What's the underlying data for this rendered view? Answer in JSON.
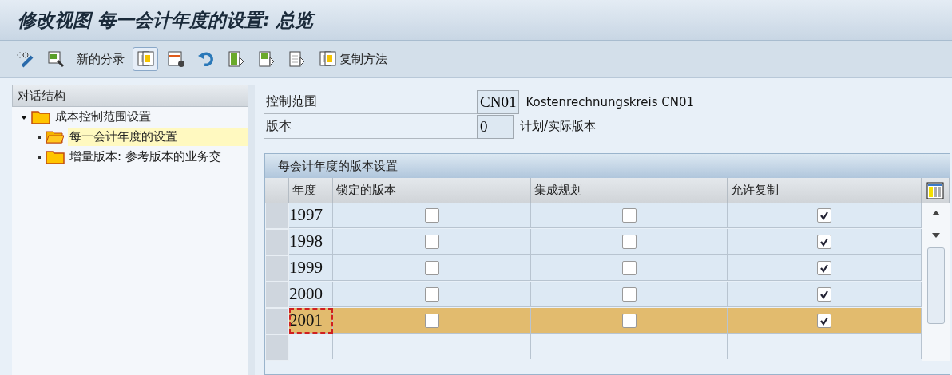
{
  "window": {
    "title": "修改视图 每一会计年度的设置: 总览"
  },
  "toolbar": [
    {
      "kind": "icon",
      "pressed": false
    },
    {
      "kind": "icon",
      "pressed": false
    },
    {
      "kind": "text",
      "label": "新的分录"
    },
    {
      "kind": "icon",
      "pressed": true
    },
    {
      "kind": "icon",
      "pressed": false
    },
    {
      "kind": "icon",
      "pressed": false
    },
    {
      "kind": "icon",
      "pressed": false
    },
    {
      "kind": "icon",
      "pressed": false
    },
    {
      "kind": "icon",
      "pressed": false
    },
    {
      "kind": "icon-text",
      "label": "复制方法",
      "pressed": false
    }
  ],
  "sidebar": {
    "title": "对话结构",
    "items": [
      {
        "label": "成本控制范围设置",
        "expanded": true,
        "selected": false,
        "children": [
          {
            "label": "每一会计年度的设置",
            "selected": true
          },
          {
            "label": "增量版本: 参考版本的业务交",
            "selected": false
          }
        ]
      }
    ]
  },
  "header_fields": [
    {
      "label": "控制范围",
      "value": "CN01",
      "description": "Kostenrechnungskreis CN01"
    },
    {
      "label": "版本",
      "value": "0",
      "description": "计划/实际版本"
    }
  ],
  "table": {
    "title": "每会计年度的版本设置",
    "columns": [
      "年度",
      "锁定的版本",
      "集成规划",
      "允许复制"
    ],
    "rows": [
      {
        "year": "1997",
        "locked": false,
        "integrated": false,
        "copy_allowed": true,
        "selected": false
      },
      {
        "year": "1998",
        "locked": false,
        "integrated": false,
        "copy_allowed": true,
        "selected": false
      },
      {
        "year": "1999",
        "locked": false,
        "integrated": false,
        "copy_allowed": true,
        "selected": false
      },
      {
        "year": "2000",
        "locked": false,
        "integrated": false,
        "copy_allowed": true,
        "selected": false
      },
      {
        "year": "2001",
        "locked": false,
        "integrated": false,
        "copy_allowed": true,
        "selected": true
      }
    ]
  }
}
